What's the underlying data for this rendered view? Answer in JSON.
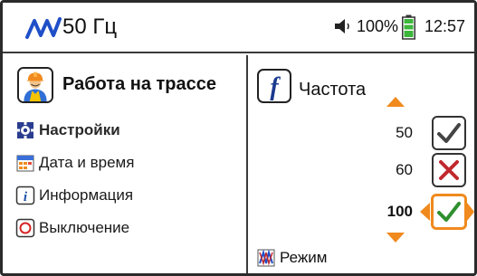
{
  "status_bar": {
    "frequency": "50 Гц",
    "battery_percent": "100%",
    "battery_level": 1.0,
    "time": "12:57"
  },
  "left_panel": {
    "title": "Работа на трассе",
    "menu": [
      {
        "label": "Настройки",
        "icon": "gear-icon"
      },
      {
        "label": "Дата и время",
        "icon": "calendar-icon"
      },
      {
        "label": "Информация",
        "icon": "info-icon"
      },
      {
        "label": "Выключение",
        "icon": "power-icon"
      }
    ]
  },
  "right_panel": {
    "title": "Частота",
    "options": [
      {
        "label": "50",
        "state": "checked"
      },
      {
        "label": "60",
        "state": "disabled"
      },
      {
        "label": "100",
        "state": "checked",
        "selected": true
      }
    ],
    "mode_label": "Режим"
  },
  "colors": {
    "accent": "#f08a1e",
    "wave": "#1f4fc8",
    "check_green": "#2f8f2f",
    "cross_red": "#c0282d",
    "battery_green": "#3bb63b"
  }
}
